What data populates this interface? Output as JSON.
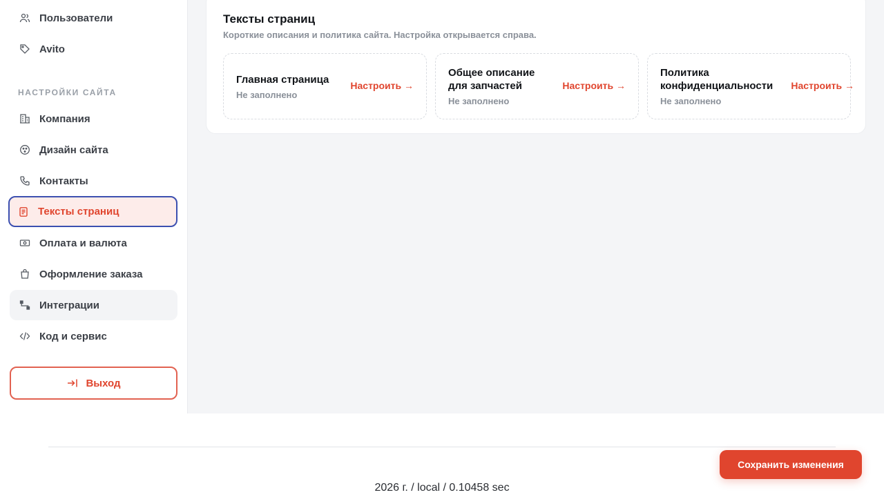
{
  "sidebar": {
    "top_items": [
      {
        "label": "Пользователи",
        "icon": "users-icon"
      },
      {
        "label": "Avito",
        "icon": "tag-icon"
      }
    ],
    "section_title": "НАСТРОЙКИ САЙТА",
    "items": [
      {
        "label": "Компания",
        "icon": "building-icon"
      },
      {
        "label": "Дизайн сайта",
        "icon": "palette-icon"
      },
      {
        "label": "Контакты",
        "icon": "phone-icon"
      },
      {
        "label": "Тексты страниц",
        "icon": "document-icon",
        "active": true
      },
      {
        "label": "Оплата и валюта",
        "icon": "banknote-icon"
      },
      {
        "label": "Оформление заказа",
        "icon": "shopping-bag-icon"
      },
      {
        "label": "Интеграции",
        "icon": "integration-icon"
      },
      {
        "label": "Код и сервис",
        "icon": "code-icon"
      }
    ],
    "logout_label": "Выход"
  },
  "main": {
    "card_title": "Тексты страниц",
    "card_subtitle": "Короткие описания и политика сайта. Настройка открывается справа.",
    "tiles": [
      {
        "name": "Главная страница",
        "status": "Не заполнено",
        "action": "Настроить →"
      },
      {
        "name": "Общее описание для запчастей",
        "status": "Не заполнено",
        "action": "Настроить →"
      },
      {
        "name": "Политика конфиденциальности",
        "status": "Не заполнено",
        "action": "Настроить →"
      }
    ]
  },
  "footer": {
    "text": "2026 г. / local / 0.10458 sec",
    "save_label": "Сохранить изменения"
  },
  "colors": {
    "accent": "#e0452e",
    "active_border": "#3b4fb0",
    "active_bg": "#fdecea"
  }
}
